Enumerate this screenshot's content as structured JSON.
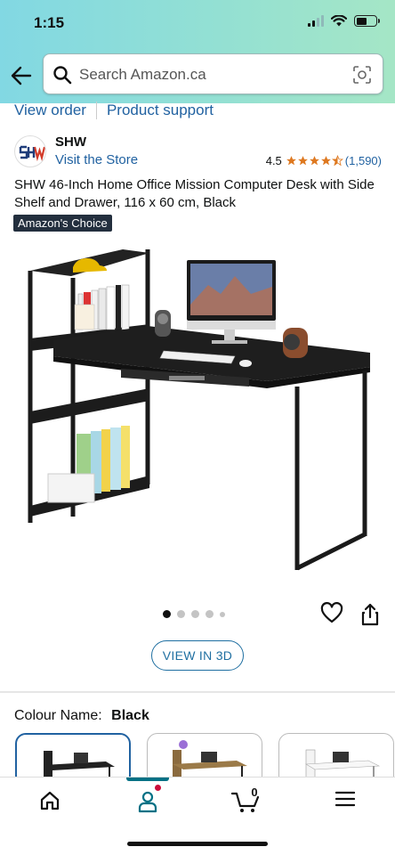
{
  "status_bar": {
    "time": "1:15"
  },
  "search": {
    "placeholder": "Search Amazon.ca",
    "value": ""
  },
  "sub_links": {
    "view_order": "View order",
    "product_support": "Product support"
  },
  "product": {
    "brand": "SHW",
    "visit_store": "Visit the Store",
    "rating": "4.5",
    "rating_count": "(1,590)",
    "title": "SHW 46-Inch Home Office Mission Computer Desk with Side Shelf and Drawer, 116 x 60 cm, Black",
    "badge": "Amazon's Choice"
  },
  "gallery": {
    "total_images": 5,
    "active_index": 0
  },
  "view_3d": "VIEW IN 3D",
  "colour": {
    "label": "Colour Name:",
    "value": "Black",
    "swatch_count": 3,
    "selected_index": 0
  },
  "cart": {
    "count": "0"
  },
  "colors": {
    "accent_teal": "#007185",
    "link_blue": "#2162a1",
    "star_orange": "#de7921",
    "badge_dark": "#232f3e"
  },
  "icons": [
    "back-arrow-icon",
    "search-icon",
    "camera-icon",
    "heart-icon",
    "share-icon",
    "home-icon",
    "account-icon",
    "cart-icon",
    "menu-icon"
  ]
}
